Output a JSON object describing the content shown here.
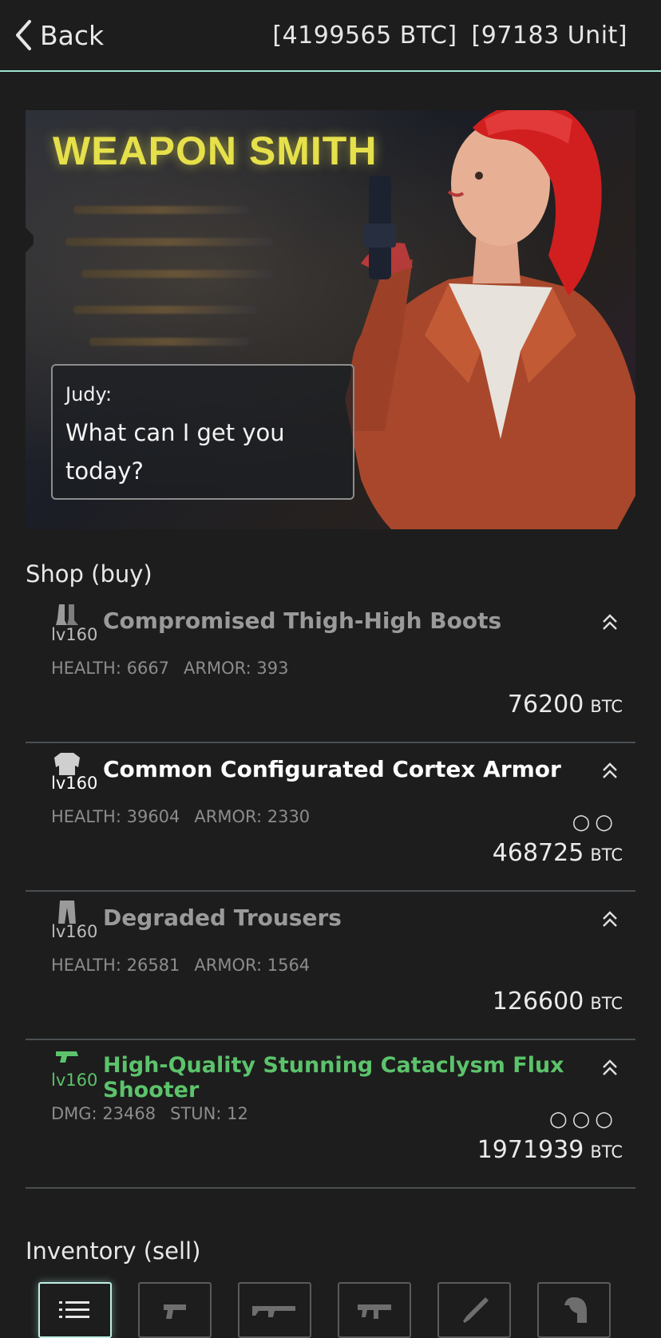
{
  "header": {
    "back_label": "Back",
    "btc": "[4199565 BTC]",
    "unit": "[97183 Unit]"
  },
  "banner": {
    "title": "WEAPON SMITH",
    "speaker": "Judy:",
    "line1": "What can I get you",
    "line2": "today?"
  },
  "shop": {
    "title": "Shop (buy)",
    "items": [
      {
        "name": "Compromised Thigh-High Boots",
        "level": "lv160",
        "stat1": "HEALTH: 6667",
        "stat2": "ARMOR: 393",
        "sockets": "",
        "price": "76200",
        "currency": "BTC",
        "icon": "boots-icon",
        "color": "#9a9a9a"
      },
      {
        "name": "Common Configurated Cortex Armor",
        "level": "lv160",
        "stat1": "HEALTH: 39604",
        "stat2": "ARMOR: 2330",
        "sockets": "○○",
        "price": "468725",
        "currency": "BTC",
        "icon": "armor-icon",
        "color": "#ffffff"
      },
      {
        "name": "Degraded Trousers",
        "level": "lv160",
        "stat1": "HEALTH: 26581",
        "stat2": "ARMOR: 1564",
        "sockets": "",
        "price": "126600",
        "currency": "BTC",
        "icon": "trousers-icon",
        "color": "#9a9a9a"
      },
      {
        "name": "High-Quality Stunning Cataclysm Flux Shooter",
        "level": "lv160",
        "stat1": "DMG: 23468",
        "stat2": "STUN: 12",
        "sockets": "○○○",
        "price": "1971939",
        "currency": "BTC",
        "icon": "pistol-icon",
        "color": "#5cc36b"
      }
    ]
  },
  "inventory": {
    "title": "Inventory (sell)",
    "tabs": [
      "list-icon",
      "pistol-icon",
      "rifle-icon",
      "smg-icon",
      "blade-icon",
      "helmet-icon"
    ]
  }
}
